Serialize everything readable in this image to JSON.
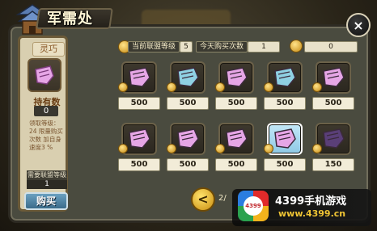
{
  "header": {
    "title": "军需处",
    "close_label": "×"
  },
  "selected_item": {
    "name": "灵巧",
    "owned_label": "持有数",
    "owned_value": "0",
    "description": "领取等级：24 限量购买次数 加自身速度3 %",
    "required_rank_label": "需要联盟等级",
    "required_rank_value": "1",
    "buy_label": "购买"
  },
  "info": {
    "alliance_rank_label": "当前联盟等级",
    "alliance_rank_value": "5",
    "daily_buys_label": "今天购买次数",
    "daily_buys_value": "1",
    "currency_value": "0"
  },
  "items": [
    {
      "price": "500",
      "icon": "pink-scroll-icon",
      "color": "#e6a6e6"
    },
    {
      "price": "500",
      "icon": "blue-scroll-icon",
      "color": "#8fd1e3"
    },
    {
      "price": "500",
      "icon": "pink-scroll-icon",
      "color": "#e6a6e6"
    },
    {
      "price": "500",
      "icon": "blue-scroll-icon",
      "color": "#8fd1e3"
    },
    {
      "price": "500",
      "icon": "pink-scroll-icon",
      "color": "#e6a6e6"
    },
    {
      "price": "500",
      "icon": "pink-scroll-icon",
      "color": "#e6a6e6"
    },
    {
      "price": "500",
      "icon": "pink-scroll-icon",
      "color": "#e6a6e6"
    },
    {
      "price": "500",
      "icon": "pink-scroll-icon",
      "color": "#e6a6e6"
    },
    {
      "price": "500",
      "icon": "pink-scroll-icon",
      "color": "#e6a6e6",
      "selected": true
    },
    {
      "price": "150",
      "icon": "dark-scroll-icon",
      "color": "#5a3f78"
    }
  ],
  "pagination": {
    "prev_label": "<",
    "page_indicator": "2/"
  },
  "watermark": {
    "logo_text": "4399",
    "title": "4399手机游戏",
    "url": "www.4399.cn"
  },
  "colors": {
    "frame": "#4a4b3f",
    "panel": "#d9cfb0",
    "accent_gold": "#f3b31c",
    "selected_bg": "#8ec9e5"
  }
}
